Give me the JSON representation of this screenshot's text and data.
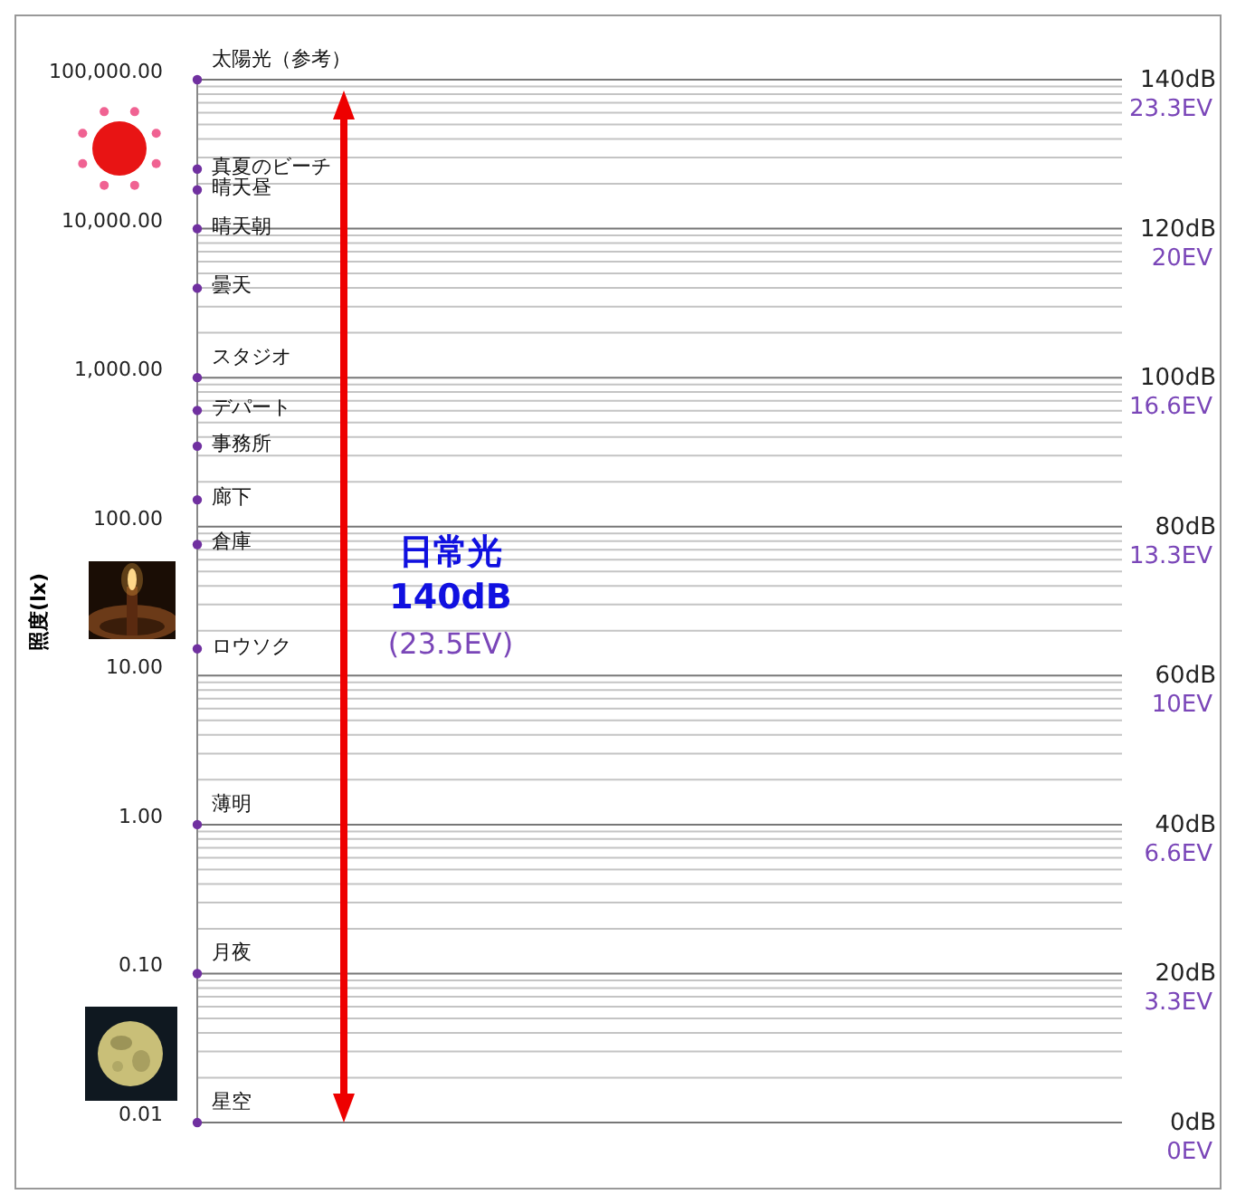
{
  "scale": {
    "axis_title": "照度(lx)",
    "ticks": [
      {
        "lux": "100,000.00",
        "db": "140dB",
        "ev": "23.3EV"
      },
      {
        "lux": "10,000.00",
        "db": "120dB",
        "ev": "20EV"
      },
      {
        "lux": "1,000.00",
        "db": "100dB",
        "ev": "16.6EV"
      },
      {
        "lux": "100.00",
        "db": "80dB",
        "ev": "13.3EV"
      },
      {
        "lux": "10.00",
        "db": "60dB",
        "ev": "10EV"
      },
      {
        "lux": "1.00",
        "db": "40dB",
        "ev": "6.6EV"
      },
      {
        "lux": "0.10",
        "db": "20dB",
        "ev": "3.3EV"
      },
      {
        "lux": "0.01",
        "db": "0dB",
        "ev": "0EV"
      }
    ]
  },
  "places": [
    "太陽光（参考）",
    "真夏のビーチ",
    "晴天昼",
    "晴天朝",
    "曇天",
    "スタジオ",
    "デパート",
    "事務所",
    "廊下",
    "倉庫",
    "ロウソク",
    "薄明",
    "月夜",
    "星空"
  ],
  "range_note": {
    "lines": [
      {
        "text": "日常光",
        "kind": "title"
      },
      {
        "text": "140dB",
        "kind": "title"
      },
      {
        "text": "(23.5EV)",
        "kind": "sub"
      }
    ]
  }
}
